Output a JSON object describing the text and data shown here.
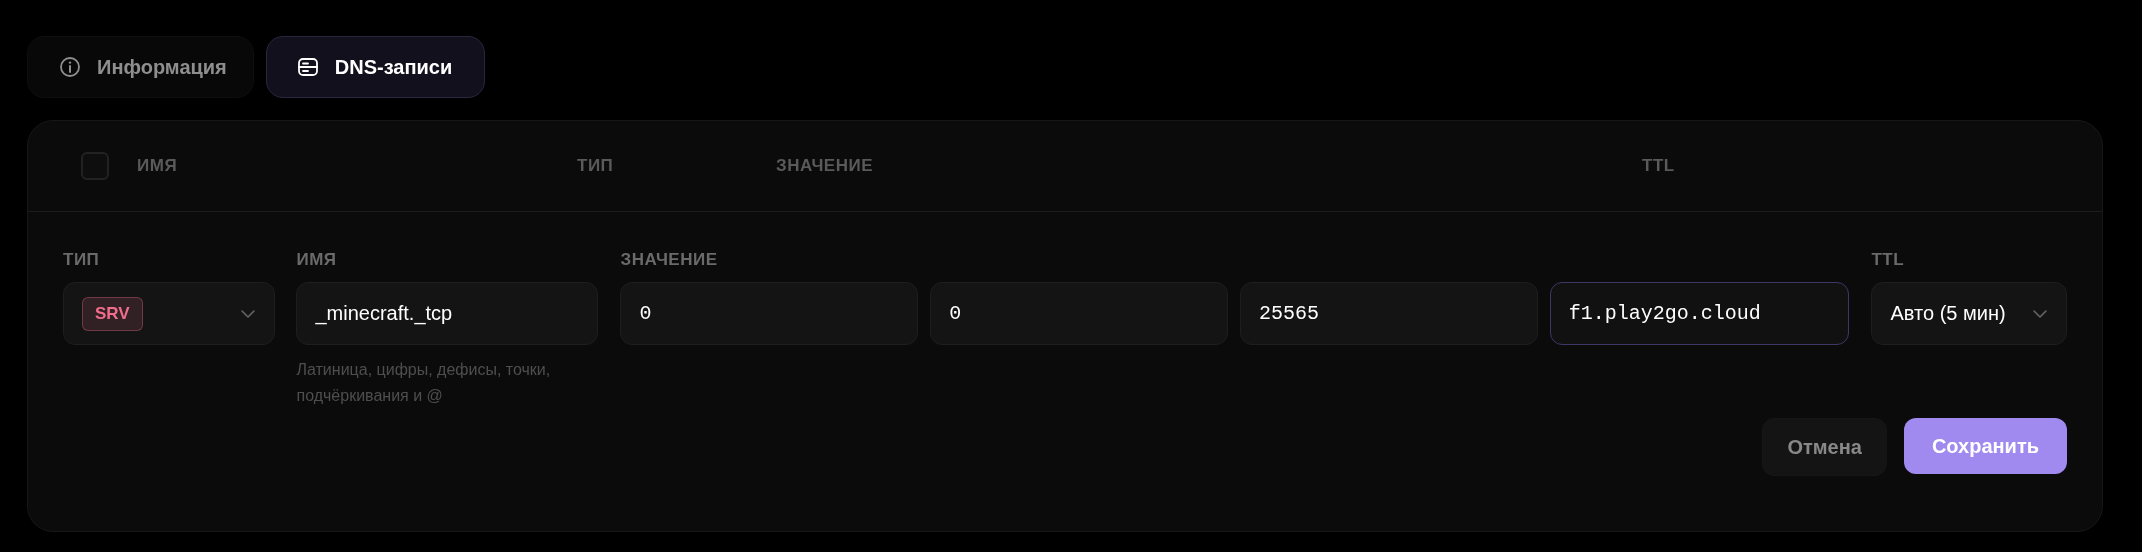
{
  "tabs": [
    {
      "label": "Информация",
      "kind": "info",
      "selected": false
    },
    {
      "label": "DNS-записи",
      "kind": "records",
      "selected": true
    }
  ],
  "table": {
    "select_all": {
      "checked": false
    },
    "columns": [
      "ИМЯ",
      "ТИП",
      "ЗНАЧЕНИЕ",
      "TTL"
    ]
  },
  "form": {
    "type": {
      "label": "ТИП",
      "value": "SRV",
      "color": "#f06d8c"
    },
    "name": {
      "label": "ИМЯ",
      "value": "_minecraft._tcp",
      "hint": "Латиница, цифры, дефисы, точки, подчёркивания и @"
    },
    "value": {
      "label": "ЗНАЧЕНИЕ",
      "fields": [
        {
          "value": "0",
          "focused": false
        },
        {
          "value": "0",
          "focused": false
        },
        {
          "value": "25565",
          "focused": false
        },
        {
          "value": "f1.play2go.cloud",
          "focused": true
        }
      ]
    },
    "ttl": {
      "label": "TTL",
      "value": "Авто (5 мин)"
    },
    "buttons": [
      {
        "label": "Отмена",
        "kind": "secondary"
      },
      {
        "label": "Сохранить",
        "kind": "primary"
      }
    ]
  }
}
